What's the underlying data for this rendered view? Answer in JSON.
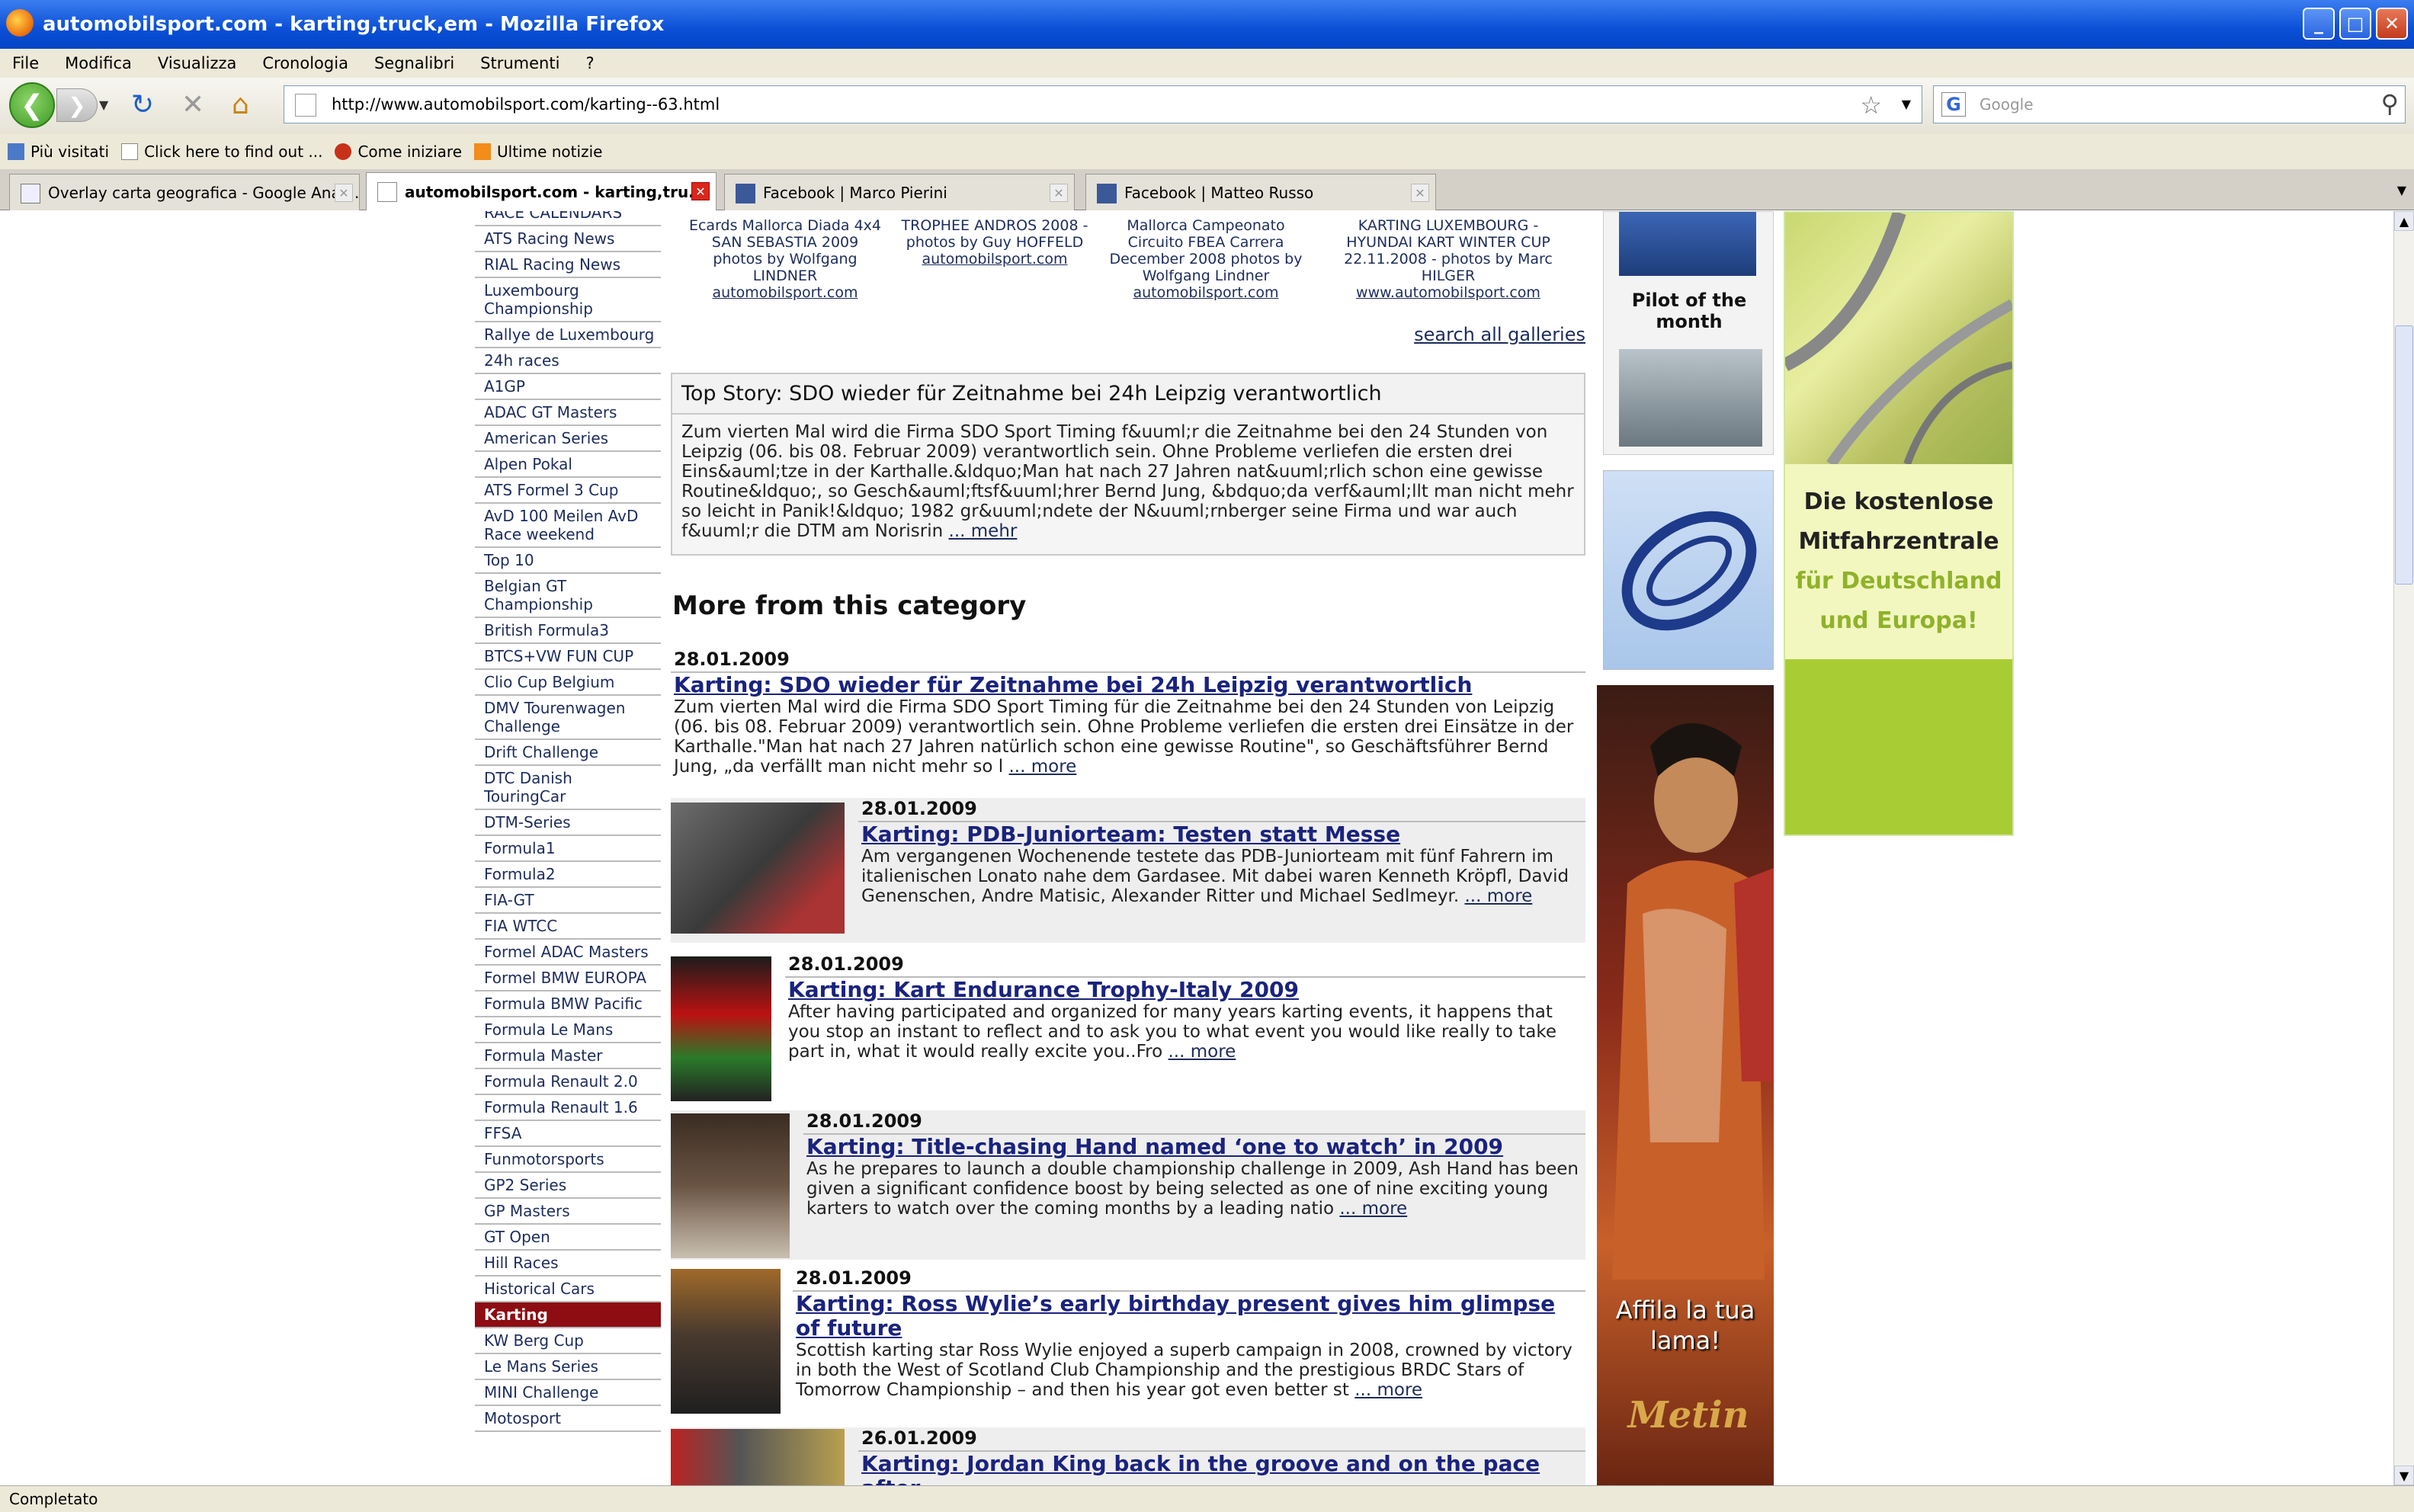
{
  "window": {
    "title": "automobilsport.com - karting,truck,em - Mozilla Firefox"
  },
  "menu": [
    "File",
    "Modifica",
    "Visualizza",
    "Cronologia",
    "Segnalibri",
    "Strumenti",
    "?"
  ],
  "nav": {
    "url": "http://www.automobilsport.com/karting--63.html",
    "search_placeholder": "Google"
  },
  "bookmarks": [
    "Più visitati",
    "Click here to find out ...",
    "Come iniziare",
    "Ultime notizie"
  ],
  "tabs": [
    {
      "label": "Overlay carta geografica - Google Anal...",
      "active": false
    },
    {
      "label": "automobilsport.com - karting,tru...",
      "active": true
    },
    {
      "label": "Facebook | Marco Pierini",
      "active": false
    },
    {
      "label": "Facebook | Matteo Russo",
      "active": false
    }
  ],
  "status": "Completato",
  "sidebar": [
    "RACE CALENDARS",
    "ATS Racing News",
    "RIAL Racing News",
    "Luxembourg Championship",
    "Rallye de Luxembourg",
    "24h races",
    "A1GP",
    "ADAC GT Masters",
    "American Series",
    "Alpen Pokal",
    "ATS Formel 3 Cup",
    "AvD 100 Meilen AvD Race weekend",
    "Top 10",
    "Belgian GT Championship",
    "British Formula3",
    "BTCS+VW FUN CUP",
    "Clio Cup Belgium",
    "DMV Tourenwagen Challenge",
    "Drift Challenge",
    "DTC Danish TouringCar",
    "DTM-Series",
    "Formula1",
    "Formula2",
    "FIA-GT",
    "FIA WTCC",
    "Formel ADAC Masters",
    "Formel BMW EUROPA",
    "Formula BMW Pacific",
    "Formula Le Mans",
    "Formula Master",
    "Formula Renault 2.0",
    "Formula Renault 1.6",
    "FFSA",
    "Funmotorsports",
    "GP2 Series",
    "GP Masters",
    "GT Open",
    "Hill Races",
    "Historical Cars",
    "Karting",
    "KW Berg Cup",
    "Le Mans Series",
    "MINI Challenge",
    "Motosport"
  ],
  "sidebar_active": "Karting",
  "galleries": [
    {
      "title": "Ecards Mallorca Diada 4x4 SAN SEBASTIA 2009 photos by Wolfgang LINDNER",
      "link": "automobilsport.com"
    },
    {
      "title": "TROPHEE ANDROS 2008 - photos by Guy HOFFELD",
      "link": "automobilsport.com"
    },
    {
      "title": "Mallorca Campeonato Circuito FBEA Carrera December 2008 photos by Wolfgang Lindner",
      "link": "automobilsport.com"
    },
    {
      "title": "KARTING LUXEMBOURG - HYUNDAI KART WINTER CUP 22.11.2008 - photos by Marc HILGER",
      "link": "www.automobilsport.com"
    }
  ],
  "search_all": "search all galleries",
  "top_story": {
    "title": "Top Story: SDO wieder für Zeitnahme bei 24h Leipzig verantwortlich",
    "text": "Zum vierten Mal wird die Firma SDO Sport Timing f&uuml;r die Zeitnahme bei den 24 Stunden von Leipzig (06. bis 08. Februar 2009) verantwortlich sein. Ohne Probleme verliefen die ersten drei Eins&auml;tze in der Karthalle.&ldquo;Man hat nach 27 Jahren nat&uuml;rlich schon eine gewisse Routine&ldquo;, so Gesch&auml;ftsf&uuml;hrer Bernd Jung, &bdquo;da verf&auml;llt man nicht mehr so leicht in Panik!&ldquo; 1982 gr&uuml;ndete der N&uuml;rnberger seine Firma und war auch f&uuml;r die DTM am Norisrin",
    "more": "... mehr"
  },
  "more_title": "More from this category",
  "articles": [
    {
      "date": "28.01.2009",
      "headline": "Karting: SDO wieder für Zeitnahme bei 24h Leipzig verantwortlich",
      "text": "Zum vierten Mal wird die Firma SDO Sport Timing für die Zeitnahme bei den 24 Stunden von Leipzig (06. bis 08. Februar 2009) verantwortlich sein. Ohne Probleme verliefen die ersten drei Einsätze in der Karthalle.\"Man hat nach 27 Jahren natürlich schon eine gewisse Routine\", so Geschäftsführer Bernd Jung, „da verfällt man nicht mehr so l",
      "more": "... more"
    },
    {
      "date": "28.01.2009",
      "headline": "Karting: PDB-Juniorteam: Testen statt Messe",
      "text": "Am vergangenen Wochenende testete das PDB-Juniorteam mit fünf Fahrern im italienischen Lonato nahe dem Gardasee. Mit dabei waren Kenneth Kröpfl, David Genenschen, Andre Matisic, Alexander Ritter und Michael Sedlmeyr.",
      "more": "... more"
    },
    {
      "date": "28.01.2009",
      "headline": "Karting: Kart Endurance Trophy-Italy 2009",
      "text": "After having participated and organized for many years karting events, it happens that you stop an instant to reflect and to ask you to what event you would like really to take part in, what it would really excite you..Fro",
      "more": "... more"
    },
    {
      "date": "28.01.2009",
      "headline": "Karting: Title-chasing Hand named ‘one to watch’ in 2009",
      "text": "As he prepares to launch a double championship challenge in 2009, Ash Hand has been given a significant confidence boost by being selected as one of nine exciting young karters to watch over the coming months by a leading natio",
      "more": "... more"
    },
    {
      "date": "28.01.2009",
      "headline": "Karting: Ross Wylie’s early birthday present gives him glimpse of future",
      "text": "Scottish karting star Ross Wylie enjoyed a superb campaign in 2008, crowned by victory in both the West of Scotland Club Championship and the prestigious BRDC Stars of Tomorrow Championship – and then his year got even better st",
      "more": "... more"
    },
    {
      "date": "26.01.2009",
      "headline": "Karting: Jordan King back in the groove and on the pace after"
    }
  ],
  "right": {
    "pilot_label": "Pilot of the month",
    "metin_text": "Affila la tua lama!",
    "metin_logo": "Metin",
    "ad2_line1": "Die kostenlose",
    "ad2_line2": "Mitfahrzentrale",
    "ad2_line3": "für Deutschland",
    "ad2_line4": "und Europa!"
  }
}
